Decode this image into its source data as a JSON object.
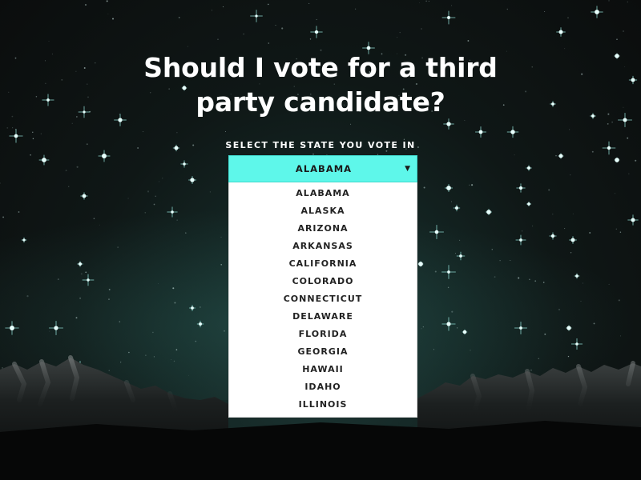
{
  "page": {
    "headline": "Should I vote for a third party candidate?",
    "select_label": "SELECT THE STATE YOU VOTE IN",
    "accent_color": "#5ef7ea",
    "background": "starry night sky over mountains"
  },
  "state_select": {
    "selected": "ALABAMA",
    "arrow_icon": "caret-down-icon",
    "options": [
      "ALABAMA",
      "ALASKA",
      "ARIZONA",
      "ARKANSAS",
      "CALIFORNIA",
      "COLORADO",
      "CONNECTICUT",
      "DELAWARE",
      "FLORIDA",
      "GEORGIA",
      "HAWAII",
      "IDAHO",
      "ILLINOIS"
    ]
  }
}
